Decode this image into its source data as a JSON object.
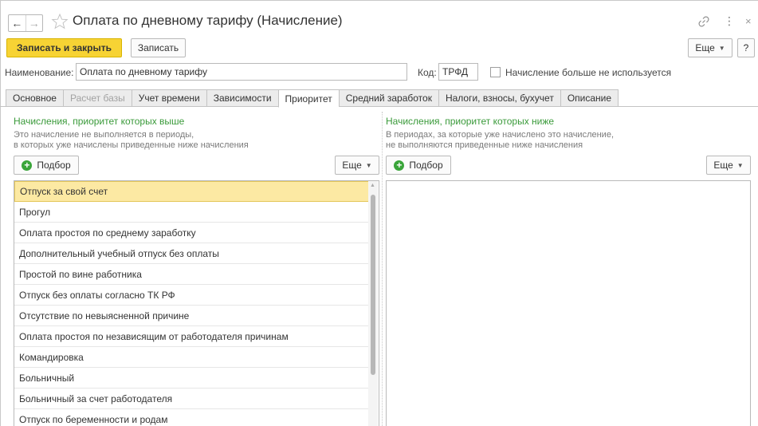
{
  "window": {
    "title": "Оплата по дневному тарифу (Начисление)",
    "back": "←",
    "forward": "→",
    "more": "⋮",
    "close": "×"
  },
  "toolbar": {
    "save_close_label": "Записать и закрыть",
    "save_label": "Записать",
    "more_label": "Еще",
    "help_label": "?"
  },
  "form": {
    "name_label": "Наименование:",
    "name_value": "Оплата по дневному тарифу",
    "code_label": "Код:",
    "code_value": "ТРФД",
    "unused_label": "Начисление больше не используется"
  },
  "tabs": [
    {
      "label": "Основное"
    },
    {
      "label": "Расчет базы"
    },
    {
      "label": "Учет времени"
    },
    {
      "label": "Зависимости"
    },
    {
      "label": "Приоритет"
    },
    {
      "label": "Средний заработок"
    },
    {
      "label": "Налоги, взносы, бухучет"
    },
    {
      "label": "Описание"
    }
  ],
  "left_panel": {
    "title": "Начисления, приоритет которых выше",
    "hint_line1": "Это начисление не выполняется в периоды,",
    "hint_line2": "в которых уже начислены приведенные ниже начисления",
    "pick_label": "Подбор",
    "more_label": "Еще",
    "items": [
      "Отпуск за свой счет",
      "Прогул",
      "Оплата простоя по среднему заработку",
      "Дополнительный учебный отпуск без оплаты",
      "Простой по вине работника",
      "Отпуск без оплаты согласно ТК РФ",
      "Отсутствие по невыясненной причине",
      "Оплата простоя по независящим от работодателя причинам",
      "Командировка",
      "Больничный",
      "Больничный за счет работодателя",
      "Отпуск по беременности и родам"
    ]
  },
  "right_panel": {
    "title": "Начисления, приоритет которых ниже",
    "hint_line1": "В периодах, за которые уже начислено это начисление,",
    "hint_line2": "не выполняются приведенные ниже начисления",
    "pick_label": "Подбор",
    "more_label": "Еще"
  },
  "colors": {
    "primary_button": "#f7d334",
    "section_title": "#3a9a3a",
    "selected_row": "#fce9a3"
  }
}
